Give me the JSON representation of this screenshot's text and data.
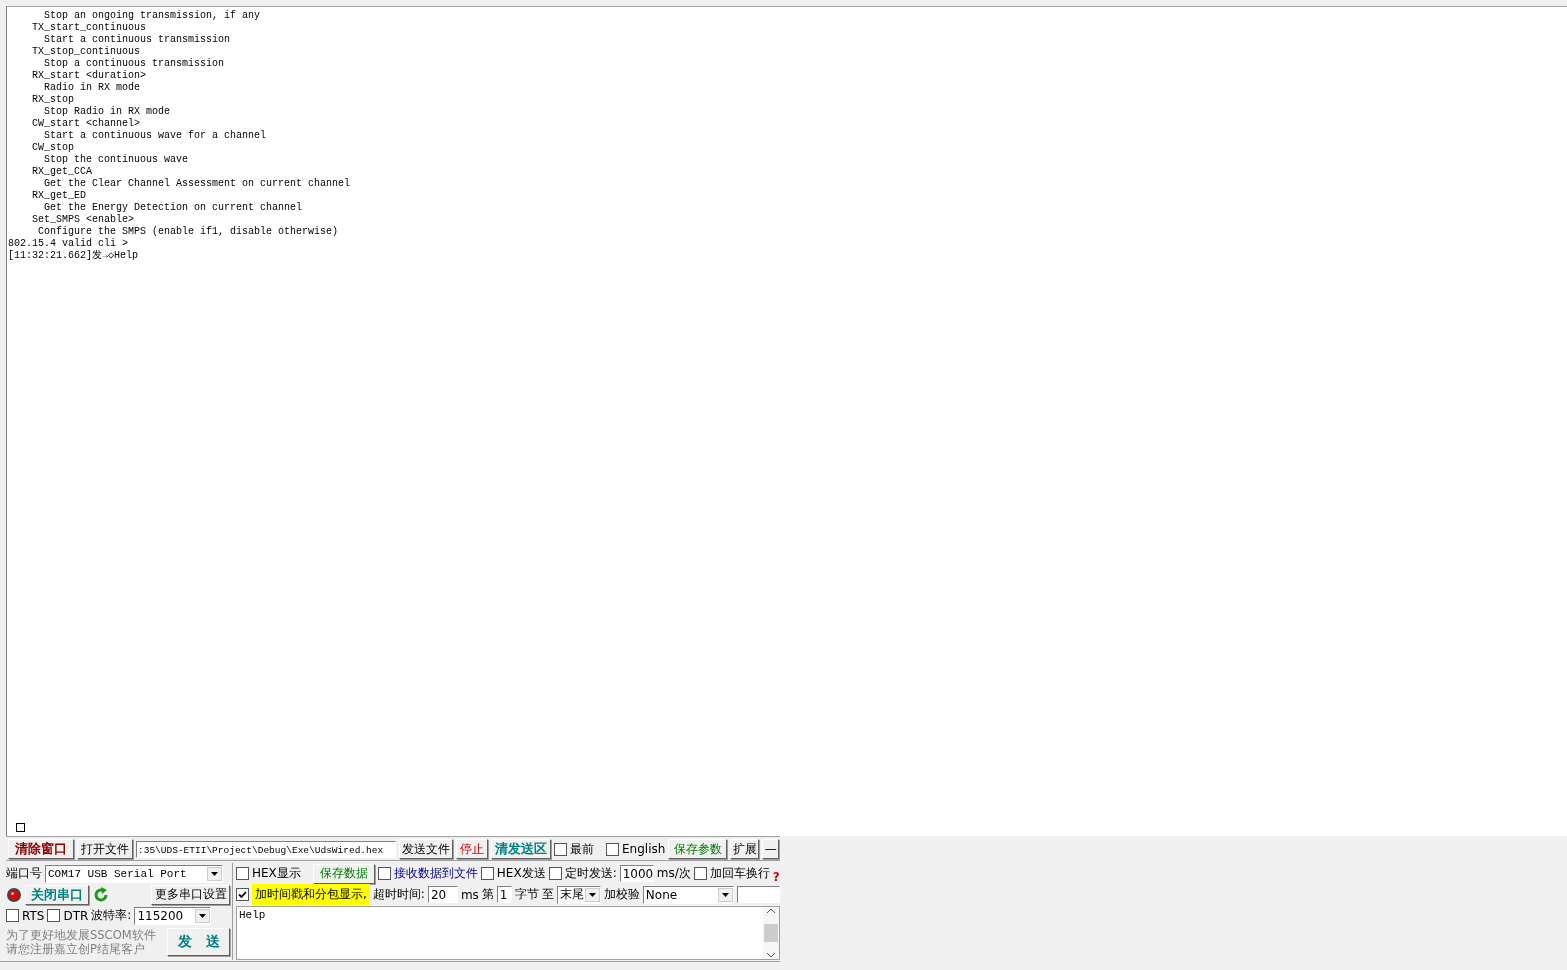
{
  "log": {
    "lines": [
      {
        "kind": "description",
        "text": "Stop an ongoing transmission, if any"
      },
      {
        "kind": "command",
        "text": "TX_start_continuous"
      },
      {
        "kind": "description",
        "text": "Start a continuous transmission"
      },
      {
        "kind": "command",
        "text": "TX_stop_continuous"
      },
      {
        "kind": "description",
        "text": "Stop a continuous transmission"
      },
      {
        "kind": "command",
        "text": "RX_start <duration>"
      },
      {
        "kind": "description",
        "text": "Radio in RX mode"
      },
      {
        "kind": "command",
        "text": "RX_stop"
      },
      {
        "kind": "description",
        "text": "Stop Radio in RX mode"
      },
      {
        "kind": "command",
        "text": "CW_start <channel>"
      },
      {
        "kind": "description",
        "text": "Start a continuous wave for a channel"
      },
      {
        "kind": "command",
        "text": "CW_stop"
      },
      {
        "kind": "description",
        "text": "Stop the continuous wave"
      },
      {
        "kind": "command",
        "text": "RX_get_CCA"
      },
      {
        "kind": "description",
        "text": "Get the Clear Channel Assessment on current channel"
      },
      {
        "kind": "command",
        "text": "RX_get_ED"
      },
      {
        "kind": "description",
        "text": "Get the Energy Detection on current channel"
      },
      {
        "kind": "command",
        "text": "Set_SMPS <enable>"
      },
      {
        "kind": "note",
        "text": "Configure the SMPS (enable if1, disable otherwise)"
      },
      {
        "kind": "prompt",
        "text": "802.15.4 valid cli >"
      },
      {
        "kind": "prompt",
        "text": "[11:32:21.662]发→◇Help"
      }
    ]
  },
  "toolbar": {
    "clear_button": "清除窗口",
    "open_file_button": "打开文件",
    "file_path": ":35\\UDS-ETII\\Project\\Debug\\Exe\\UdsWired.hex",
    "send_file_button": "发送文件",
    "stop_button": "停止",
    "clear_send_button": "清发送区",
    "topmost": {
      "label": "最前",
      "checked": false
    },
    "english": {
      "label": "English",
      "checked": false
    },
    "save_params_button": "保存参数",
    "expand_button": "扩展",
    "minimize_button": "—"
  },
  "port": {
    "label": "端口号",
    "value": "COM17 USB Serial Port",
    "close_button": "关闭串口",
    "more_settings_button": "更多串口设置",
    "rts": {
      "label": "RTS",
      "checked": false
    },
    "dtr": {
      "label": "DTR",
      "checked": false
    },
    "baud_label": "波特率:",
    "baud": "115200",
    "promo": [
      "为了更好地发展SSCOM软件",
      "请您注册嘉立创P结尾客户"
    ],
    "send_button": "发　送"
  },
  "options": {
    "hex_display": {
      "label": "HEX显示",
      "checked": false
    },
    "save_data_button": "保存数据",
    "receive_to_file": {
      "label": "接收数据到文件",
      "checked": false
    },
    "hex_send": {
      "label": "HEX发送",
      "checked": false
    },
    "timed_send": {
      "label": "定时发送:",
      "checked": false
    },
    "interval": "1000",
    "interval_unit": "ms/次",
    "add_crlf": {
      "label": "加回车换行",
      "checked": false
    },
    "help": "?",
    "timestamp": {
      "label": "加时间戳和分包显示,",
      "checked": true
    },
    "timeout_label": "超时时间:",
    "timeout": "20",
    "timeout_unit": "ms",
    "byte_from_label": "第",
    "byte_from": "1",
    "byte_label": "字节",
    "to_label": "至",
    "byte_to": "末尾",
    "checksum_label": "加校验",
    "checksum": "None"
  },
  "send_text": "Help"
}
